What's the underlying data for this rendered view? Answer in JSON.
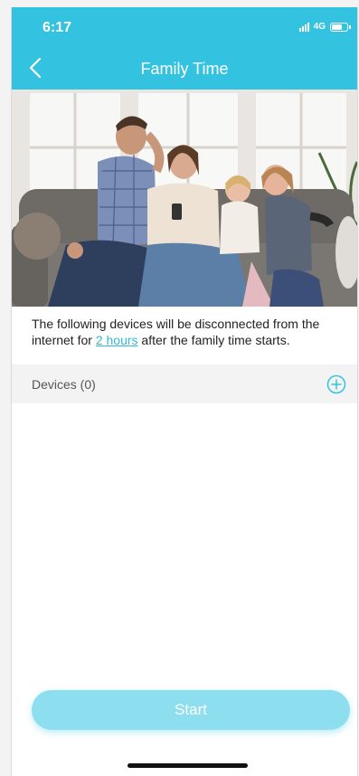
{
  "status_bar": {
    "time": "6:17",
    "network": "4G"
  },
  "header": {
    "title": "Family Time"
  },
  "description": {
    "before_link": "The following devices will be disconnected from the internet for ",
    "link": "2 hours",
    "after_link": " after the family time starts."
  },
  "devices": {
    "label": "Devices (0)"
  },
  "start_button": {
    "label": "Start"
  },
  "colors": {
    "accent": "#33c3e0",
    "button_disabled": "#8ddff0",
    "link": "#33b8d8"
  }
}
